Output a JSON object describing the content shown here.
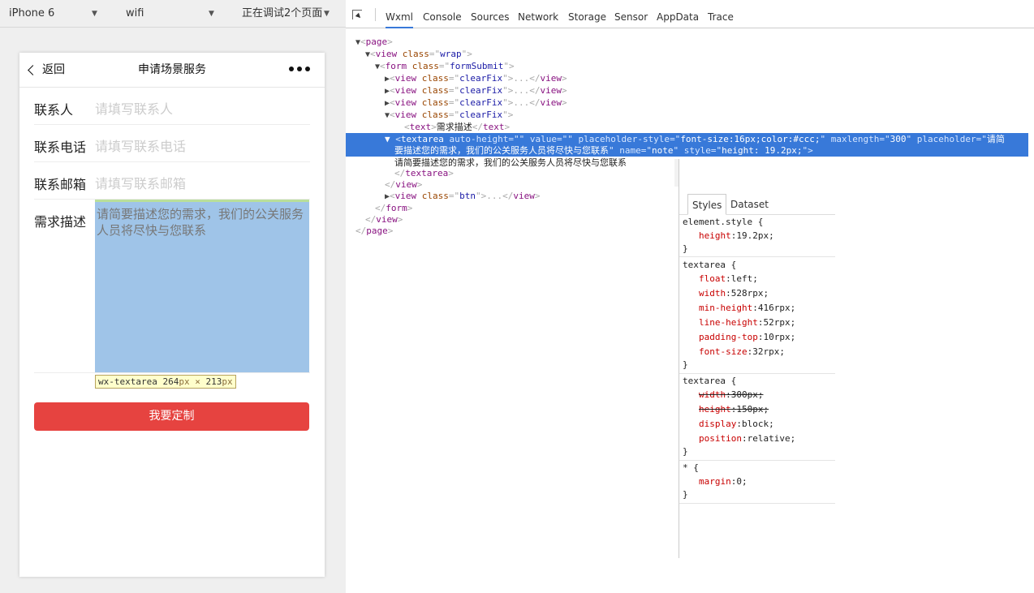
{
  "simulator": {
    "device": "iPhone 6",
    "network": "wifi",
    "debug_status": "正在调试2个页面"
  },
  "phone": {
    "nav": {
      "back": "返回",
      "title": "申请场景服务"
    },
    "form": [
      {
        "label": "联系人",
        "placeholder": "请填写联系人"
      },
      {
        "label": "联系电话",
        "placeholder": "请填写联系电话"
      },
      {
        "label": "联系邮箱",
        "placeholder": "请填写联系邮箱"
      },
      {
        "label": "需求描述",
        "placeholder": "请简要描述您的需求，我们的公关服务人员将尽快与您联系"
      }
    ],
    "highlight_tooltip": {
      "name": "wx-textarea",
      "w": "264",
      "h": "213",
      "unit": "px",
      "sep": "×"
    },
    "submit": "我要定制"
  },
  "devtools": {
    "tabs": [
      "Wxml",
      "Console",
      "Sources",
      "Network",
      "Storage",
      "Sensor",
      "AppData",
      "Trace"
    ],
    "active_tab": "Wxml",
    "tree": {
      "page_open": "page",
      "view_wrap": {
        "tag": "view",
        "attr": "class",
        "val": "wrap"
      },
      "form": {
        "tag": "form",
        "attr": "class",
        "val": "formSubmit"
      },
      "clearfix_class": "clearFix",
      "collapsed": "...",
      "text_tag": "text",
      "text_content": "需求描述",
      "textarea": {
        "tag": "textarea",
        "a1": "auto-height",
        "v1": "",
        "a2": "value",
        "v2": "",
        "a3": "placeholder-style",
        "v3": "font-size:16px;color:#ccc;",
        "a4": "maxlength",
        "v4": "300",
        "a5": "placeholder",
        "v5a": "请简",
        "v5b": "要描述您的需求，我们的公关服务人员将尽快与您联系",
        "a6": "name",
        "v6": "note",
        "a7": "style",
        "v7": "height: 19.2px;"
      },
      "textarea_text": "请简要描述您的需求，我们的公关服务人员将尽快与您联系",
      "btn_class": "btn",
      "close_view": "view",
      "close_form": "form",
      "close_page": "page"
    },
    "styles_pane": {
      "tabs": [
        "Styles",
        "Dataset"
      ],
      "rules": [
        {
          "selector": "element.style {",
          "props": [
            [
              "height",
              "19.2px;"
            ]
          ],
          "struck": []
        },
        {
          "selector": "textarea {",
          "props": [
            [
              "float",
              "left;"
            ],
            [
              "width",
              "528rpx;"
            ],
            [
              "min-height",
              "416rpx;"
            ],
            [
              "line-height",
              "52rpx;"
            ],
            [
              "padding-top",
              "10rpx;"
            ],
            [
              "font-size",
              "32rpx;"
            ]
          ],
          "struck": []
        },
        {
          "selector": "textarea {",
          "props": [
            [
              "width",
              "300px;"
            ],
            [
              "height",
              "150px;"
            ],
            [
              "display",
              "block;"
            ],
            [
              "position",
              "relative;"
            ]
          ],
          "struck": [
            0,
            1
          ]
        },
        {
          "selector": "* {",
          "props": [
            [
              "margin",
              "0;"
            ]
          ],
          "struck": []
        }
      ],
      "close": "}"
    }
  }
}
